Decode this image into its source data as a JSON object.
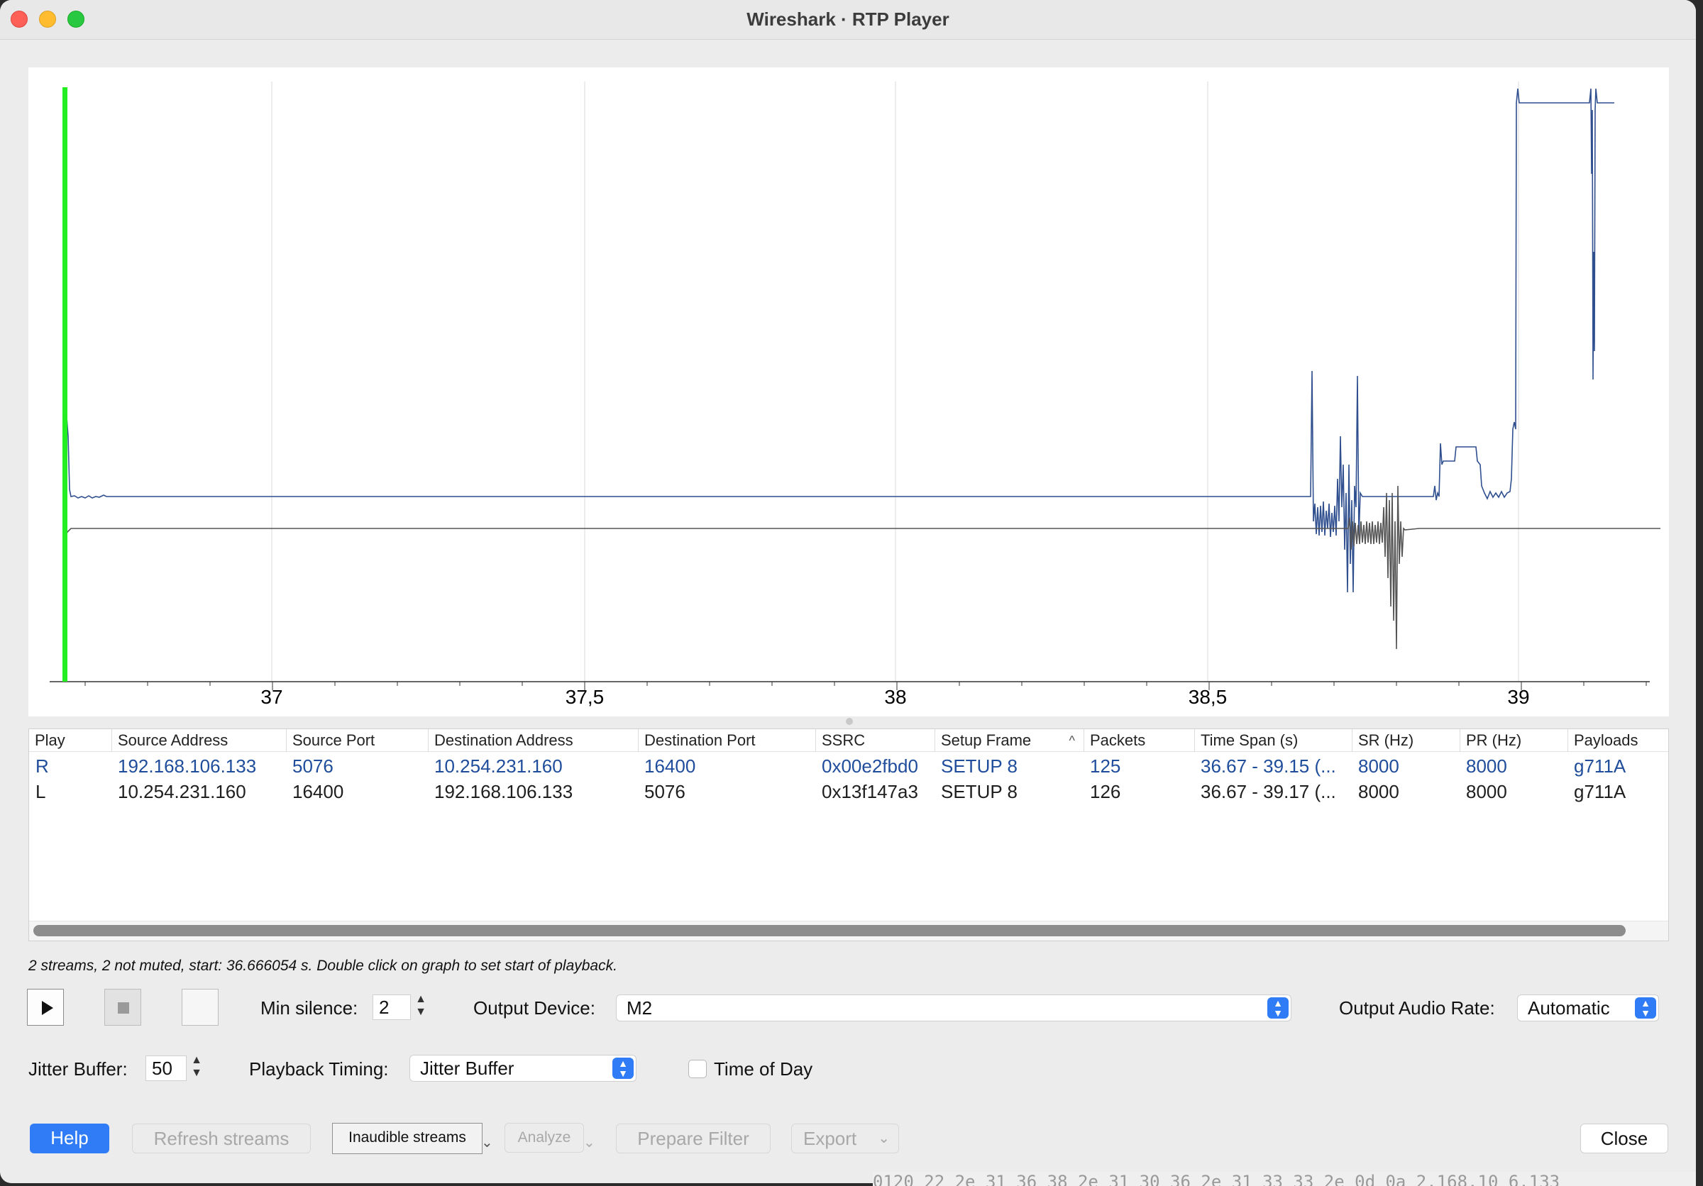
{
  "window": {
    "title": "Wireshark · RTP Player"
  },
  "graph": {
    "x_ticks": [
      "37",
      "37,5",
      "38",
      "38,5",
      "39"
    ],
    "colors": {
      "playhead": "#22ee22",
      "stream_r": "#2f4f8f",
      "stream_l": "#555555",
      "grid": "#e6e6e6"
    }
  },
  "table": {
    "columns": [
      "Play",
      "Source Address",
      "Source Port",
      "Destination Address",
      "Destination Port",
      "SSRC",
      "Setup Frame",
      "Packets",
      "Time Span (s)",
      "SR (Hz)",
      "PR (Hz)",
      "Payloads"
    ],
    "rows": [
      [
        "R",
        "192.168.106.133",
        "5076",
        "10.254.231.160",
        "16400",
        "0x00e2fbd0",
        "SETUP 8",
        "125",
        "36.67 - 39.15 (...",
        "8000",
        "8000",
        "g711A"
      ],
      [
        "L",
        "10.254.231.160",
        "16400",
        "192.168.106.133",
        "5076",
        "0x13f147a3",
        "SETUP 8",
        "126",
        "36.67 - 39.17 (...",
        "8000",
        "8000",
        "g711A"
      ]
    ]
  },
  "status_text": "2 streams, 2 not muted, start: 36.666054 s. Double click on graph to set start of playback.",
  "controls": {
    "min_silence_label": "Min silence:",
    "min_silence_value": "2",
    "output_device_label": "Output Device:",
    "output_device_value": "M2",
    "output_audio_rate_label": "Output Audio Rate:",
    "output_audio_rate_value": "Automatic",
    "jitter_buffer_label": "Jitter Buffer:",
    "jitter_buffer_value": "50",
    "playback_timing_label": "Playback Timing:",
    "playback_timing_value": "Jitter Buffer",
    "time_of_day_label": "Time of Day"
  },
  "buttons": {
    "help": "Help",
    "refresh": "Refresh streams",
    "inaudible": "Inaudible streams",
    "analyze": "Analyze",
    "prepare_filter": "Prepare Filter",
    "export": "Export",
    "close": "Close"
  },
  "icons": {
    "up": "▲",
    "down": "▼",
    "sort": "^",
    "chevron": "⌄",
    "bg_text": "0120  22 2e 31 36 38 2e 31 30  36 2e 31 33 33 2e 0d 0a  2.168.10 6.133"
  }
}
